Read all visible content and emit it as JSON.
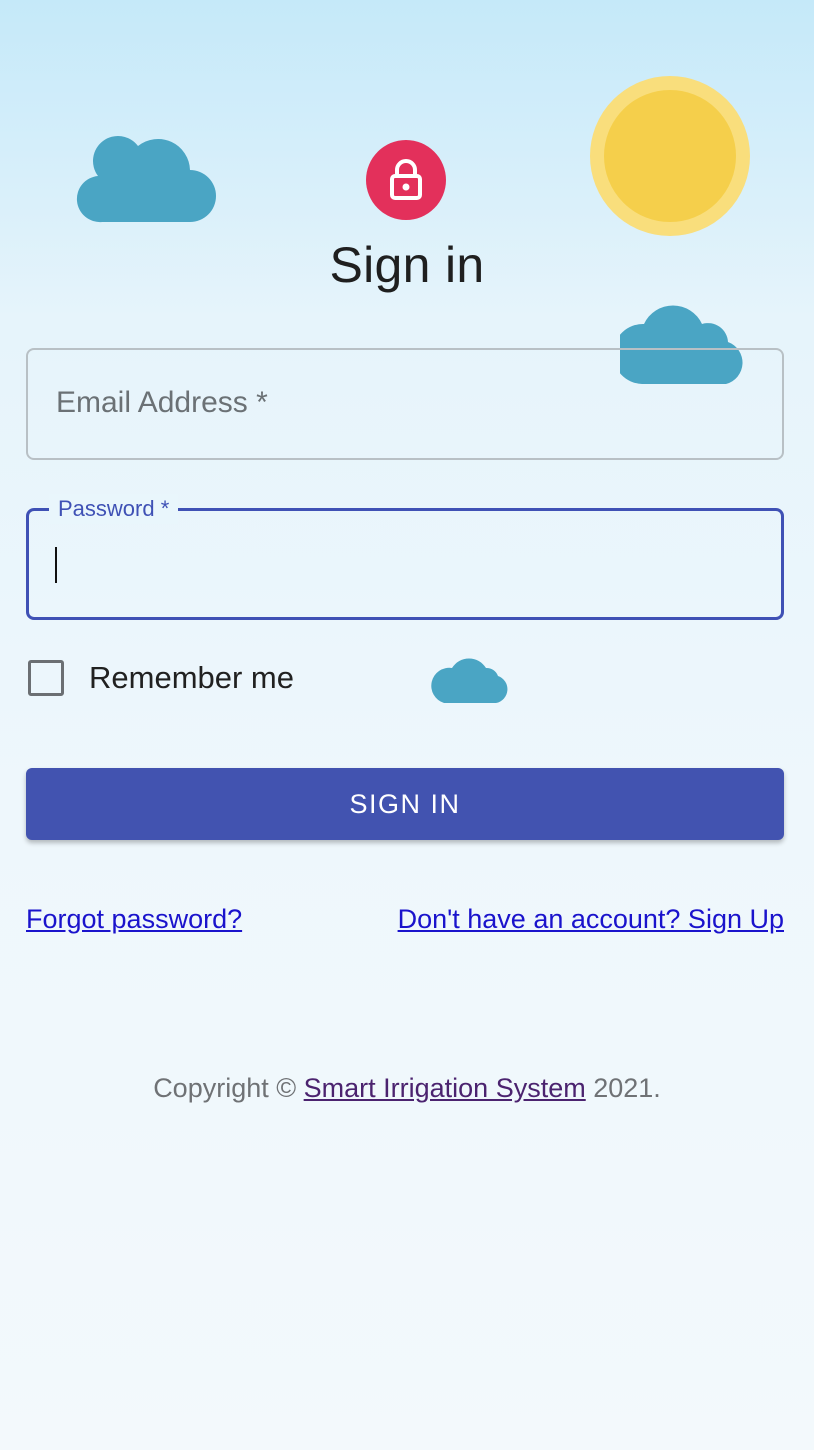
{
  "header": {
    "title": "Sign in"
  },
  "form": {
    "email": {
      "label": "Email Address",
      "required_mark": "*",
      "value": ""
    },
    "password": {
      "label": "Password",
      "required_mark": "*",
      "value": ""
    },
    "remember": {
      "label": "Remember me",
      "checked": false
    },
    "submit_label": "SIGN IN"
  },
  "links": {
    "forgot": "Forgot password?",
    "signup": "Don't have an account? Sign Up"
  },
  "footer": {
    "prefix": "Copyright © ",
    "brand": "Smart Irrigation System",
    "suffix": " 2021."
  },
  "icons": {
    "avatar": "lock-icon",
    "decor": [
      "cloud-icon",
      "sun-icon"
    ]
  },
  "colors": {
    "primary": "#3f51b5",
    "avatar": "#e3305b",
    "cloud": "#4aa5c4",
    "sun": "#f5cf4b",
    "link": "#1a13cc"
  }
}
